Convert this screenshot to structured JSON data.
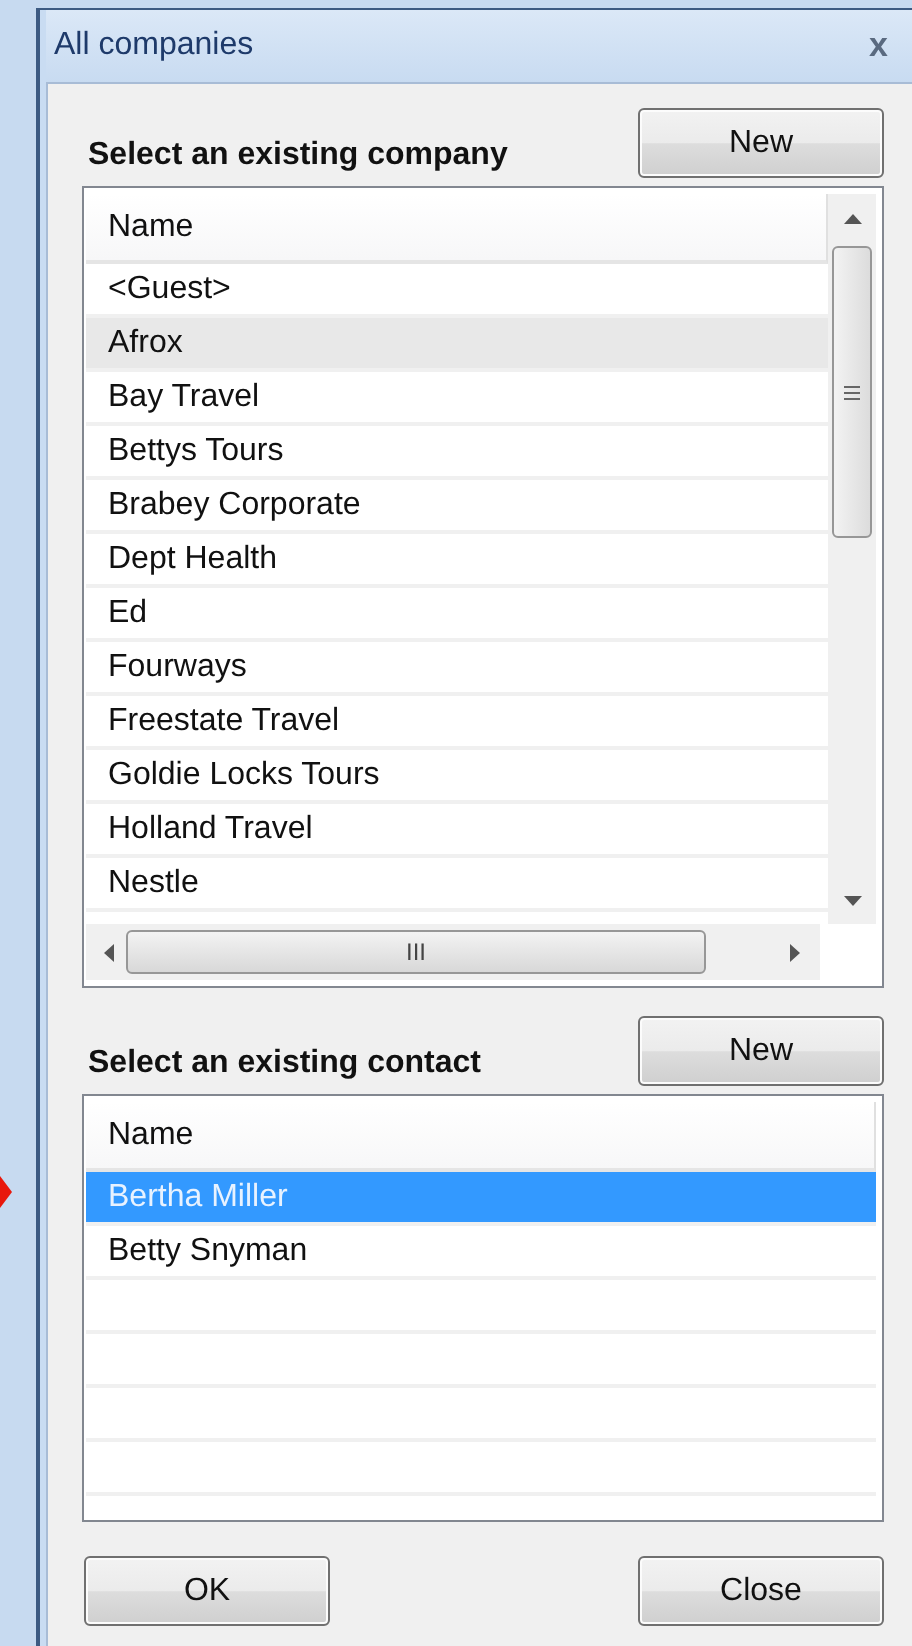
{
  "window": {
    "title": "All companies",
    "close": "x"
  },
  "company_section": {
    "label": "Select an existing company",
    "new_button": "New"
  },
  "company_list": {
    "focused": false,
    "columns": [
      "Name"
    ],
    "rows": [
      {
        "name": "<Guest>",
        "selected": false
      },
      {
        "name": "Afrox",
        "selected": true
      },
      {
        "name": "Bay Travel",
        "selected": false
      },
      {
        "name": "Bettys Tours",
        "selected": false
      },
      {
        "name": "Brabey Corporate",
        "selected": false
      },
      {
        "name": "Dept Health",
        "selected": false
      },
      {
        "name": "Ed",
        "selected": false
      },
      {
        "name": "Fourways",
        "selected": false
      },
      {
        "name": "Freestate Travel",
        "selected": false
      },
      {
        "name": "Goldie Locks Tours",
        "selected": false
      },
      {
        "name": "Holland Travel",
        "selected": false
      },
      {
        "name": "Nestle",
        "selected": false
      }
    ],
    "hscroll_grip": "III"
  },
  "contact_section": {
    "label": "Select an existing contact",
    "new_button": "New"
  },
  "contact_list": {
    "focused": true,
    "columns": [
      "Name"
    ],
    "rows": [
      {
        "name": "Bertha Miller",
        "selected": true
      },
      {
        "name": "Betty Snyman",
        "selected": false
      }
    ]
  },
  "buttons": [
    "OK",
    "Close"
  ]
}
